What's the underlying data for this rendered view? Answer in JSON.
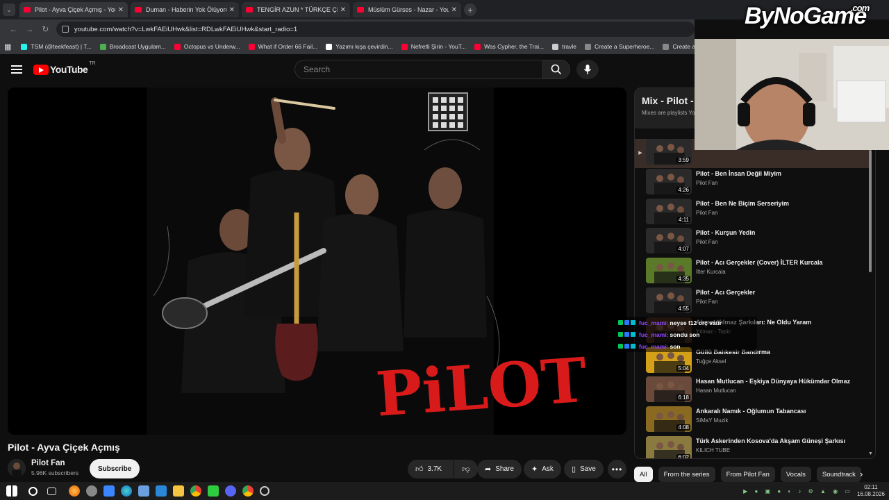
{
  "browser": {
    "tabs": [
      {
        "title": "Pilot - Ayva Çiçek Açmış - YouTube",
        "active": true
      },
      {
        "title": "Duman - Haberin Yok Ölüyorum",
        "active": false
      },
      {
        "title": "TENGİR AZUN * TÜRKÇE ÇEVİRİ",
        "active": false
      },
      {
        "title": "Müslüm Gürses - Nazar - YouTube",
        "active": false
      }
    ],
    "url": "youtube.com/watch?v=LwkFAEiUHwk&list=RDLwkFAEiUHwk&start_radio=1",
    "bookmarks": [
      {
        "label": "TSM (@teekfeast) | T...",
        "color": "#25f4ee"
      },
      {
        "label": "Broadcast Uygulam...",
        "color": "#4caf50"
      },
      {
        "label": "Octopus vs Underw...",
        "color": "#ff0033"
      },
      {
        "label": "What if Order 66 Fail...",
        "color": "#ff0033"
      },
      {
        "label": "Yazımı kışa çevirdin...",
        "color": "#ffffff"
      },
      {
        "label": "Nefretli Şirin - YouT...",
        "color": "#ff0033"
      },
      {
        "label": "Was Cypher, the Trai...",
        "color": "#ff0033"
      },
      {
        "label": "travle",
        "color": "#cccccc"
      },
      {
        "label": "Create a Superheroe...",
        "color": "#888888"
      },
      {
        "label": "Create a Star Wars C...",
        "color": "#888888"
      }
    ]
  },
  "youtube": {
    "logo_text": "YouTube",
    "country": "TR",
    "search_placeholder": "Search"
  },
  "video": {
    "title": "Pilot - Ayva Çiçek Açmış",
    "overlay_text": "PiLOT",
    "channel": "Pilot Fan",
    "subscribers": "5.96K subscribers",
    "subscribe_label": "Subscribe",
    "likes": "3.7K",
    "share_label": "Share",
    "ask_label": "Ask",
    "save_label": "Save"
  },
  "mix": {
    "title": "Mix - Pilot - A",
    "subtitle": "Mixes are playlists Yo",
    "items": [
      {
        "title": "",
        "channel": "Pilot Fan",
        "duration": "3:59",
        "current": true,
        "thumb": "#2a2a2a"
      },
      {
        "title": "Pilot - Ben İnsan Değil Miyim",
        "channel": "Pilot Fan",
        "duration": "4:26",
        "current": false,
        "thumb": "#2a2a2a"
      },
      {
        "title": "Pilot - Ben Ne Biçim Serseriyim",
        "channel": "Pilot Fan",
        "duration": "4:11",
        "current": false,
        "thumb": "#2a2a2a"
      },
      {
        "title": "Pilot - Kurşun Yedin",
        "channel": "Pilot Fan",
        "duration": "4:07",
        "current": false,
        "thumb": "#2a2a2a"
      },
      {
        "title": "Pilot - Acı Gerçekler (Cover) İLTER Kurcala",
        "channel": "İlter Kurcala",
        "duration": "4:35",
        "current": false,
        "thumb": "#5a7a2a"
      },
      {
        "title": "Pilot - Acı Gerçekler",
        "channel": "Pilot Fan",
        "duration": "4:55",
        "current": false,
        "thumb": "#2a2a2a"
      },
      {
        "title": "Ahmet Yılmaz Şarkıları: Ne Oldu Yaram",
        "channel": "Yılmaz - Topic",
        "duration": "",
        "current": false,
        "thumb": "#4a3020"
      },
      {
        "title": "Güllü Balıkesir Bandırma",
        "channel": "Tuğçe Aksel",
        "duration": "5:04",
        "current": false,
        "thumb": "#d4a017"
      },
      {
        "title": "Hasan Mutlucan - Eşkiya Dünyaya Hükümdar Olmaz",
        "channel": "Hasan Mutlucan",
        "duration": "6:18",
        "current": false,
        "thumb": "#6a4a3a"
      },
      {
        "title": "Ankaralı Namık - Oğlumun Tabancası",
        "channel": "SiMaY Muzik",
        "duration": "4:08",
        "current": false,
        "thumb": "#8a6a20"
      },
      {
        "title": "Türk Askerinden Kosova'da Akşam Güneşi Şarkısı",
        "channel": "KILICH TUBE",
        "duration": "6:02",
        "current": false,
        "thumb": "#8a7a40"
      }
    ]
  },
  "chips": [
    {
      "label": "All",
      "active": true
    },
    {
      "label": "From the series",
      "active": false
    },
    {
      "label": "From Pilot Fan",
      "active": false
    },
    {
      "label": "Vocals",
      "active": false
    },
    {
      "label": "Soundtrack",
      "active": false
    }
  ],
  "chat": [
    {
      "user": "fuc_mami",
      "message": "neyse f12 orç vatır"
    },
    {
      "user": "fuc_mami",
      "message": "sondu son"
    },
    {
      "user": "fuc_mami",
      "message": "son"
    }
  ],
  "overlay_brand": {
    "text": "ByNoGame",
    "suffix": ".com"
  },
  "taskbar": {
    "time": "02:11",
    "date": "16.08.2026"
  }
}
